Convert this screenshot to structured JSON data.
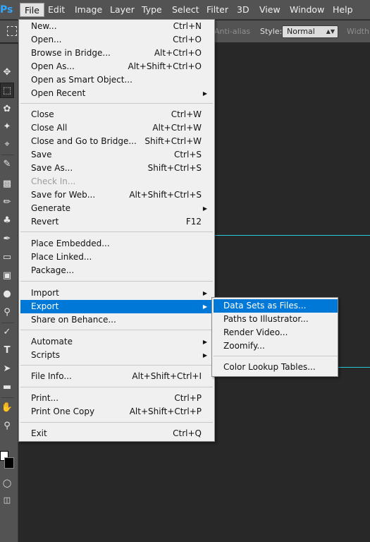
{
  "app": {
    "logo": "Ps"
  },
  "menubar": {
    "items": [
      "File",
      "Edit",
      "Image",
      "Layer",
      "Type",
      "Select",
      "Filter",
      "3D",
      "View",
      "Window",
      "Help"
    ]
  },
  "options": {
    "antialias_label": "Anti-alias",
    "style_label": "Style:",
    "style_value": "Normal",
    "width_label": "Width:"
  },
  "file_menu": {
    "items": [
      {
        "label": "New...",
        "shortcut": "Ctrl+N"
      },
      {
        "label": "Open...",
        "shortcut": "Ctrl+O"
      },
      {
        "label": "Browse in Bridge...",
        "shortcut": "Alt+Ctrl+O"
      },
      {
        "label": "Open As...",
        "shortcut": "Alt+Shift+Ctrl+O"
      },
      {
        "label": "Open as Smart Object...",
        "shortcut": ""
      },
      {
        "label": "Open Recent",
        "shortcut": ""
      },
      {
        "label": "Close",
        "shortcut": "Ctrl+W"
      },
      {
        "label": "Close All",
        "shortcut": "Alt+Ctrl+W"
      },
      {
        "label": "Close and Go to Bridge...",
        "shortcut": "Shift+Ctrl+W"
      },
      {
        "label": "Save",
        "shortcut": "Ctrl+S"
      },
      {
        "label": "Save As...",
        "shortcut": "Shift+Ctrl+S"
      },
      {
        "label": "Check In...",
        "shortcut": ""
      },
      {
        "label": "Save for Web...",
        "shortcut": "Alt+Shift+Ctrl+S"
      },
      {
        "label": "Generate",
        "shortcut": ""
      },
      {
        "label": "Revert",
        "shortcut": "F12"
      },
      {
        "label": "Place Embedded...",
        "shortcut": ""
      },
      {
        "label": "Place Linked...",
        "shortcut": ""
      },
      {
        "label": "Package...",
        "shortcut": ""
      },
      {
        "label": "Import",
        "shortcut": ""
      },
      {
        "label": "Export",
        "shortcut": ""
      },
      {
        "label": "Share on Behance...",
        "shortcut": ""
      },
      {
        "label": "Automate",
        "shortcut": ""
      },
      {
        "label": "Scripts",
        "shortcut": ""
      },
      {
        "label": "File Info...",
        "shortcut": "Alt+Shift+Ctrl+I"
      },
      {
        "label": "Print...",
        "shortcut": "Ctrl+P"
      },
      {
        "label": "Print One Copy",
        "shortcut": "Alt+Shift+Ctrl+P"
      },
      {
        "label": "Exit",
        "shortcut": "Ctrl+Q"
      }
    ]
  },
  "export_submenu": {
    "items": [
      "Data Sets as Files...",
      "Paths to Illustrator...",
      "Render Video...",
      "Zoomify...",
      "Color Lookup Tables..."
    ]
  },
  "tools": [
    "move-tool",
    "marquee-tool",
    "lasso-tool",
    "magic-wand-tool",
    "crop-tool",
    "eyedropper-tool",
    "healing-tool",
    "brush-tool",
    "clone-stamp-tool",
    "history-brush-tool",
    "eraser-tool",
    "gradient-tool",
    "blur-tool",
    "dodge-tool",
    "pen-tool",
    "type-tool",
    "path-selection-tool",
    "rectangle-tool",
    "hand-tool",
    "zoom-tool"
  ],
  "colors": {
    "accent": "#0078d7",
    "guide": "#28c8d6",
    "canvas": "#282828"
  }
}
